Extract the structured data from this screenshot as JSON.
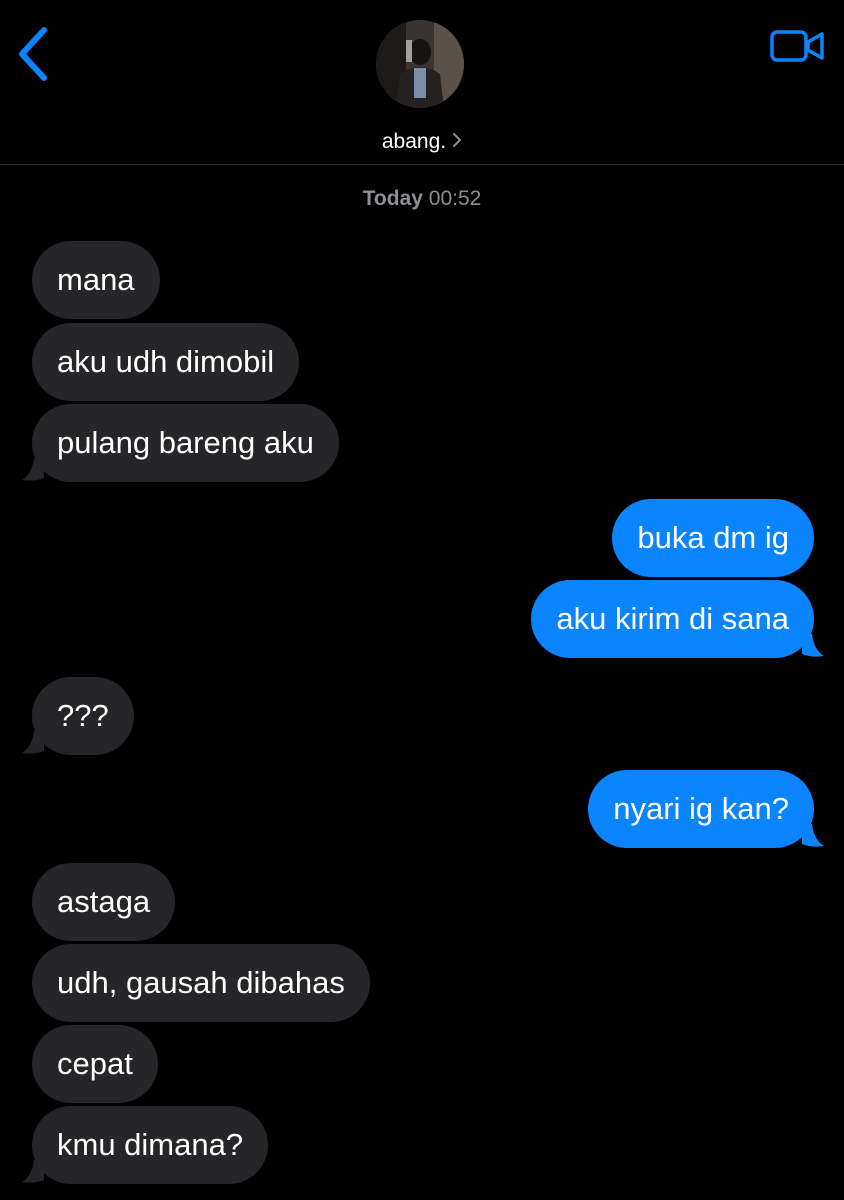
{
  "header": {
    "back_icon": "chevron-left-icon",
    "video_icon": "video-camera-icon",
    "contact_name": "abang.",
    "name_chevron_icon": "chevron-right-icon",
    "accent_color": "#0a84ff"
  },
  "conversation": {
    "timestamp_day": "Today",
    "timestamp_time": "00:52",
    "messages": [
      {
        "direction": "incoming",
        "text": "mana"
      },
      {
        "direction": "incoming",
        "text": "aku udh dimobil"
      },
      {
        "direction": "incoming",
        "text": "pulang bareng aku"
      },
      {
        "direction": "outgoing",
        "text": "buka dm ig"
      },
      {
        "direction": "outgoing",
        "text": "aku kirim di sana"
      },
      {
        "direction": "incoming",
        "text": "???"
      },
      {
        "direction": "outgoing",
        "text": "nyari ig kan?"
      },
      {
        "direction": "incoming",
        "text": "astaga"
      },
      {
        "direction": "incoming",
        "text": "udh, gausah dibahas"
      },
      {
        "direction": "incoming",
        "text": "cepat"
      },
      {
        "direction": "incoming",
        "text": "kmu dimana?"
      }
    ]
  },
  "colors": {
    "incoming_bubble": "#262629",
    "outgoing_bubble": "#0a84ff",
    "background": "#000000",
    "timestamp_text": "#8e8e93"
  }
}
